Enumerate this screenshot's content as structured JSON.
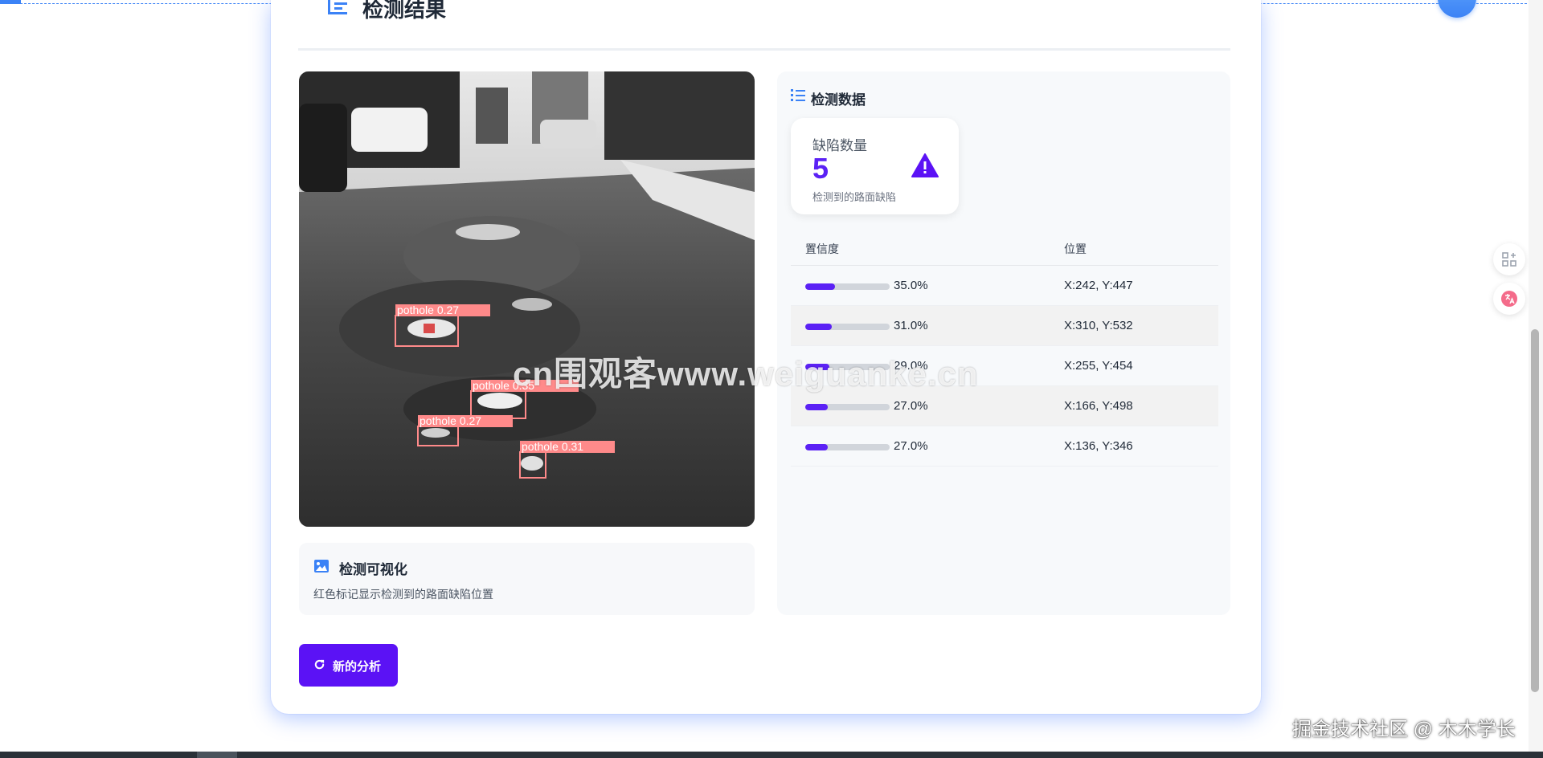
{
  "header": {
    "title": "检测结果"
  },
  "visualization": {
    "title": "检测可视化",
    "description": "红色标记显示检测到的路面缺陷位置",
    "detections": [
      {
        "label": "pothole  0.27"
      },
      {
        "label": "pothole  0.35"
      },
      {
        "label": "pothole  0.27"
      },
      {
        "label": "pothole  0.31"
      }
    ]
  },
  "data_panel": {
    "title": "检测数据",
    "count_card": {
      "label": "缺陷数量",
      "value": "5",
      "sub": "检测到的路面缺陷"
    },
    "table": {
      "columns": [
        "置信度",
        "位置"
      ],
      "rows": [
        {
          "confidence_pct": 35.0,
          "confidence": "35.0%",
          "position": "X:242, Y:447"
        },
        {
          "confidence_pct": 31.0,
          "confidence": "31.0%",
          "position": "X:310, Y:532"
        },
        {
          "confidence_pct": 29.0,
          "confidence": "29.0%",
          "position": "X:255, Y:454"
        },
        {
          "confidence_pct": 27.0,
          "confidence": "27.0%",
          "position": "X:166, Y:498"
        },
        {
          "confidence_pct": 27.0,
          "confidence": "27.0%",
          "position": "X:136, Y:346"
        }
      ]
    }
  },
  "actions": {
    "new_analysis": "新的分析"
  },
  "overlay": {
    "watermark": "cn围观客www.weiguanke.cn",
    "credit": "掘金技术社区 @ 木木学长"
  },
  "colors": {
    "accent": "#5b12f5",
    "detection_box": "#ff8a8a",
    "header_icon": "#3b82f6"
  },
  "icons": {
    "header": "list-indent-icon",
    "data": "list-ordered-icon",
    "warning": "warning-triangle-icon",
    "visualization": "image-icon",
    "refresh": "refresh-icon",
    "side_grid": "grid-plus-icon",
    "side_translate": "translate-icon"
  }
}
